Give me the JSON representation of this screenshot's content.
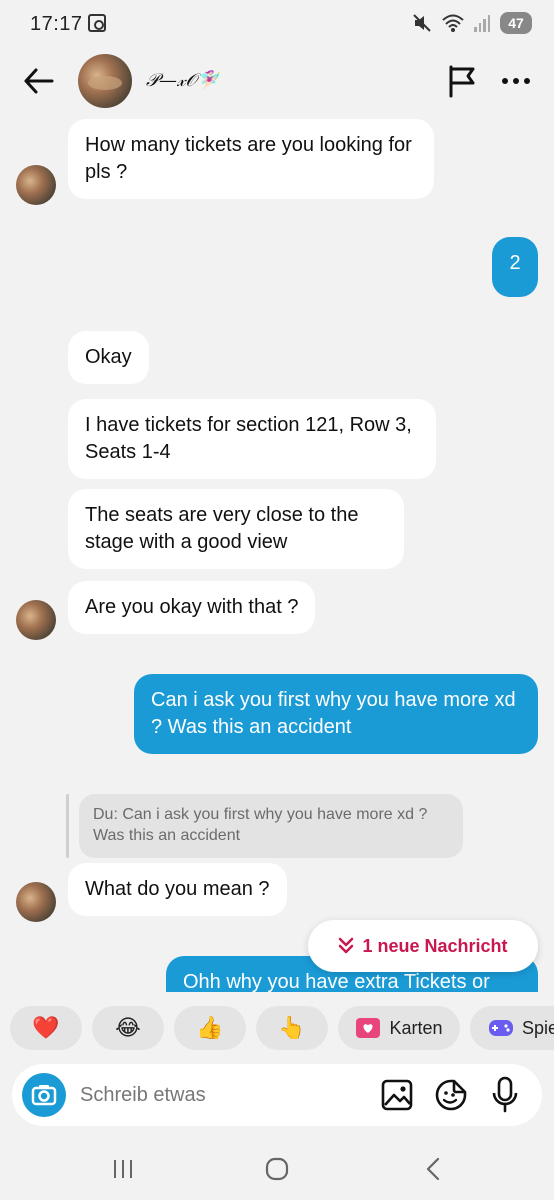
{
  "status_bar": {
    "time": "17:17",
    "battery": "47"
  },
  "header": {
    "contact_name": "𝒫—𝓍𝒪🧚🏻‍♀️"
  },
  "messages": {
    "m1": "How many tickets are you looking for pls ?",
    "m2": "2",
    "m3": "Okay",
    "m4": "I have tickets for section 121, Row 3, Seats 1-4",
    "m5": "The seats are very close to the stage with a good view",
    "m6": "Are you okay with that ?",
    "m7": "Can i ask you first why you have more xd ? Was this an accident",
    "reply_quote": "Du: Can i ask you first why you have more xd ? Was this an accident",
    "m8": "What do you mean ?",
    "m9": "Ohh why you have extra Tickets or"
  },
  "new_message_pill": {
    "icon": "double-chevron-down",
    "label": "1 neue Nachricht"
  },
  "quick_reactions": {
    "heart": "❤️",
    "laugh": "😂",
    "thumbs_up": "👍",
    "point_up": "👆",
    "cards_label": "Karten",
    "games_label": "Spie"
  },
  "composer": {
    "placeholder": "Schreib etwas"
  },
  "colors": {
    "outgoing_bubble": "#1a9bd6",
    "incoming_bubble": "#ffffff",
    "background": "#f2f2f2",
    "accent_pill": "#c8184e"
  }
}
